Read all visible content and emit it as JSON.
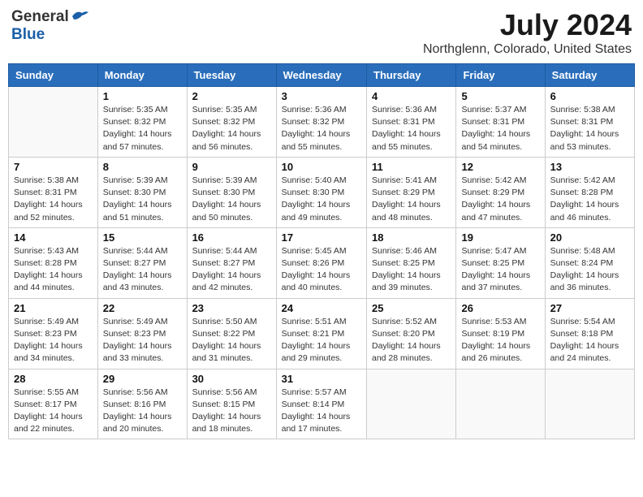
{
  "header": {
    "logo_general": "General",
    "logo_blue": "Blue",
    "month": "July 2024",
    "location": "Northglenn, Colorado, United States"
  },
  "weekdays": [
    "Sunday",
    "Monday",
    "Tuesday",
    "Wednesday",
    "Thursday",
    "Friday",
    "Saturday"
  ],
  "weeks": [
    [
      {
        "day": "",
        "info": ""
      },
      {
        "day": "1",
        "info": "Sunrise: 5:35 AM\nSunset: 8:32 PM\nDaylight: 14 hours\nand 57 minutes."
      },
      {
        "day": "2",
        "info": "Sunrise: 5:35 AM\nSunset: 8:32 PM\nDaylight: 14 hours\nand 56 minutes."
      },
      {
        "day": "3",
        "info": "Sunrise: 5:36 AM\nSunset: 8:32 PM\nDaylight: 14 hours\nand 55 minutes."
      },
      {
        "day": "4",
        "info": "Sunrise: 5:36 AM\nSunset: 8:31 PM\nDaylight: 14 hours\nand 55 minutes."
      },
      {
        "day": "5",
        "info": "Sunrise: 5:37 AM\nSunset: 8:31 PM\nDaylight: 14 hours\nand 54 minutes."
      },
      {
        "day": "6",
        "info": "Sunrise: 5:38 AM\nSunset: 8:31 PM\nDaylight: 14 hours\nand 53 minutes."
      }
    ],
    [
      {
        "day": "7",
        "info": "Sunrise: 5:38 AM\nSunset: 8:31 PM\nDaylight: 14 hours\nand 52 minutes."
      },
      {
        "day": "8",
        "info": "Sunrise: 5:39 AM\nSunset: 8:30 PM\nDaylight: 14 hours\nand 51 minutes."
      },
      {
        "day": "9",
        "info": "Sunrise: 5:39 AM\nSunset: 8:30 PM\nDaylight: 14 hours\nand 50 minutes."
      },
      {
        "day": "10",
        "info": "Sunrise: 5:40 AM\nSunset: 8:30 PM\nDaylight: 14 hours\nand 49 minutes."
      },
      {
        "day": "11",
        "info": "Sunrise: 5:41 AM\nSunset: 8:29 PM\nDaylight: 14 hours\nand 48 minutes."
      },
      {
        "day": "12",
        "info": "Sunrise: 5:42 AM\nSunset: 8:29 PM\nDaylight: 14 hours\nand 47 minutes."
      },
      {
        "day": "13",
        "info": "Sunrise: 5:42 AM\nSunset: 8:28 PM\nDaylight: 14 hours\nand 46 minutes."
      }
    ],
    [
      {
        "day": "14",
        "info": "Sunrise: 5:43 AM\nSunset: 8:28 PM\nDaylight: 14 hours\nand 44 minutes."
      },
      {
        "day": "15",
        "info": "Sunrise: 5:44 AM\nSunset: 8:27 PM\nDaylight: 14 hours\nand 43 minutes."
      },
      {
        "day": "16",
        "info": "Sunrise: 5:44 AM\nSunset: 8:27 PM\nDaylight: 14 hours\nand 42 minutes."
      },
      {
        "day": "17",
        "info": "Sunrise: 5:45 AM\nSunset: 8:26 PM\nDaylight: 14 hours\nand 40 minutes."
      },
      {
        "day": "18",
        "info": "Sunrise: 5:46 AM\nSunset: 8:25 PM\nDaylight: 14 hours\nand 39 minutes."
      },
      {
        "day": "19",
        "info": "Sunrise: 5:47 AM\nSunset: 8:25 PM\nDaylight: 14 hours\nand 37 minutes."
      },
      {
        "day": "20",
        "info": "Sunrise: 5:48 AM\nSunset: 8:24 PM\nDaylight: 14 hours\nand 36 minutes."
      }
    ],
    [
      {
        "day": "21",
        "info": "Sunrise: 5:49 AM\nSunset: 8:23 PM\nDaylight: 14 hours\nand 34 minutes."
      },
      {
        "day": "22",
        "info": "Sunrise: 5:49 AM\nSunset: 8:23 PM\nDaylight: 14 hours\nand 33 minutes."
      },
      {
        "day": "23",
        "info": "Sunrise: 5:50 AM\nSunset: 8:22 PM\nDaylight: 14 hours\nand 31 minutes."
      },
      {
        "day": "24",
        "info": "Sunrise: 5:51 AM\nSunset: 8:21 PM\nDaylight: 14 hours\nand 29 minutes."
      },
      {
        "day": "25",
        "info": "Sunrise: 5:52 AM\nSunset: 8:20 PM\nDaylight: 14 hours\nand 28 minutes."
      },
      {
        "day": "26",
        "info": "Sunrise: 5:53 AM\nSunset: 8:19 PM\nDaylight: 14 hours\nand 26 minutes."
      },
      {
        "day": "27",
        "info": "Sunrise: 5:54 AM\nSunset: 8:18 PM\nDaylight: 14 hours\nand 24 minutes."
      }
    ],
    [
      {
        "day": "28",
        "info": "Sunrise: 5:55 AM\nSunset: 8:17 PM\nDaylight: 14 hours\nand 22 minutes."
      },
      {
        "day": "29",
        "info": "Sunrise: 5:56 AM\nSunset: 8:16 PM\nDaylight: 14 hours\nand 20 minutes."
      },
      {
        "day": "30",
        "info": "Sunrise: 5:56 AM\nSunset: 8:15 PM\nDaylight: 14 hours\nand 18 minutes."
      },
      {
        "day": "31",
        "info": "Sunrise: 5:57 AM\nSunset: 8:14 PM\nDaylight: 14 hours\nand 17 minutes."
      },
      {
        "day": "",
        "info": ""
      },
      {
        "day": "",
        "info": ""
      },
      {
        "day": "",
        "info": ""
      }
    ]
  ]
}
